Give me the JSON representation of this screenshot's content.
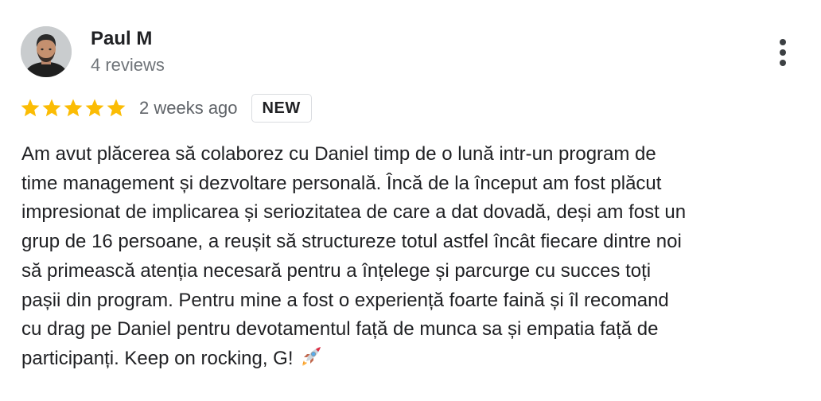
{
  "review": {
    "author": {
      "name": "Paul M",
      "reviews_count": "4 reviews",
      "avatar_icon": "user-photo"
    },
    "rating": {
      "stars": 5,
      "max_stars": 5,
      "star_color": "#fbbc04"
    },
    "date": "2 weeks ago",
    "badge": "NEW",
    "more_options_icon": "vertical-ellipsis-icon",
    "text_lines": [
      "Am avut plăcerea să colaborez cu Daniel timp de o lună intr-un program de",
      "time management și dezvoltare personală. Încă de la început am fost plăcut",
      "impresionat de implicarea și seriozitatea de care a dat dovadă, deși am fost un",
      "grup de 16 persoane, a reușit să structureze totul astfel încât fiecare dintre noi",
      "să primească atenția necesară pentru a înțelege și parcurge cu succes toți",
      "pașii din program. Pentru mine a fost o experiență foarte faină și îl recomand",
      "cu drag pe Daniel pentru devotamentul față de munca sa și empatia față de",
      "participanți. Keep on rocking, G!"
    ],
    "trailing_emoji_icon": "rocket-icon"
  }
}
